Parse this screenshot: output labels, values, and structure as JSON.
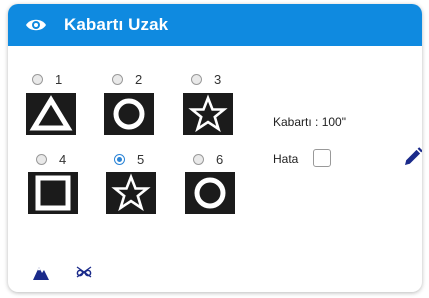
{
  "header": {
    "title": "Kabartı Uzak",
    "icon": "eye-icon",
    "color": "#0f8ae0"
  },
  "options": [
    {
      "label": "1",
      "shape": "triangle",
      "selected": false
    },
    {
      "label": "2",
      "shape": "circle",
      "selected": false
    },
    {
      "label": "3",
      "shape": "star",
      "selected": false
    },
    {
      "label": "4",
      "shape": "square",
      "selected": false
    },
    {
      "label": "5",
      "shape": "star",
      "selected": true
    },
    {
      "label": "6",
      "shape": "circle",
      "selected": false
    }
  ],
  "info": {
    "kabarti": "Kabartı : 100\"",
    "hata": "Hata"
  },
  "colors": {
    "accent": "#0f8ae0",
    "tile": "#1b1b1b",
    "icon": "#1a2a8a"
  }
}
